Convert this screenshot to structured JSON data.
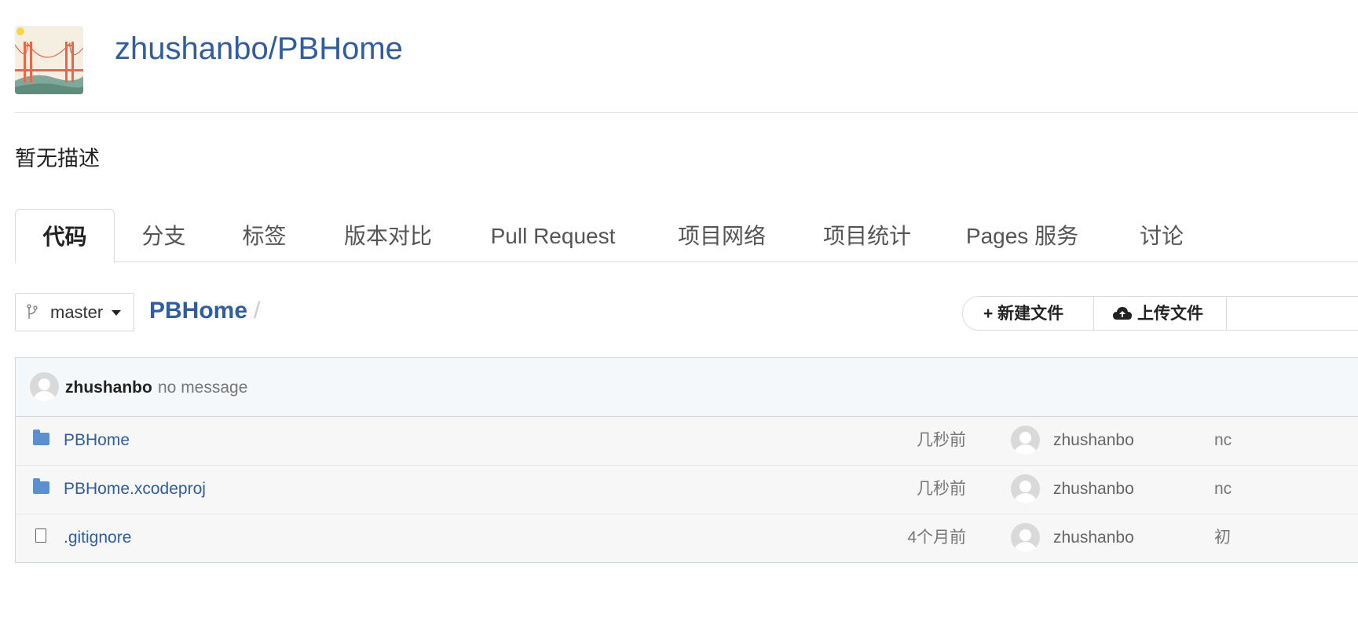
{
  "repo": {
    "title": "zhushanbo/PBHome",
    "description": "暂无描述"
  },
  "tabs": [
    {
      "label": "代码",
      "active": true
    },
    {
      "label": "分支"
    },
    {
      "label": "标签"
    },
    {
      "label": "版本对比"
    },
    {
      "label": "Pull Request"
    },
    {
      "label": "项目网络"
    },
    {
      "label": "项目统计"
    },
    {
      "label": "Pages 服务"
    },
    {
      "label": "讨论"
    }
  ],
  "toolbar": {
    "branch": "master",
    "breadcrumb_root": "PBHome",
    "breadcrumb_sep": "/",
    "new_file_label": "+ 新建文件",
    "upload_label": "上传文件"
  },
  "commit": {
    "author": "zhushanbo",
    "message": "no message"
  },
  "files": [
    {
      "type": "folder",
      "name": "PBHome",
      "time": "几秒前",
      "author": "zhushanbo",
      "message": "nc"
    },
    {
      "type": "folder",
      "name": "PBHome.xcodeproj",
      "time": "几秒前",
      "author": "zhushanbo",
      "message": "nc"
    },
    {
      "type": "file",
      "name": ".gitignore",
      "time": "4个月前",
      "author": "zhushanbo",
      "message": "初"
    }
  ],
  "colors": {
    "link": "#2f5d9f",
    "folder_icon": "#5b8fcf",
    "commit_bar_bg": "#f5f8fa"
  }
}
